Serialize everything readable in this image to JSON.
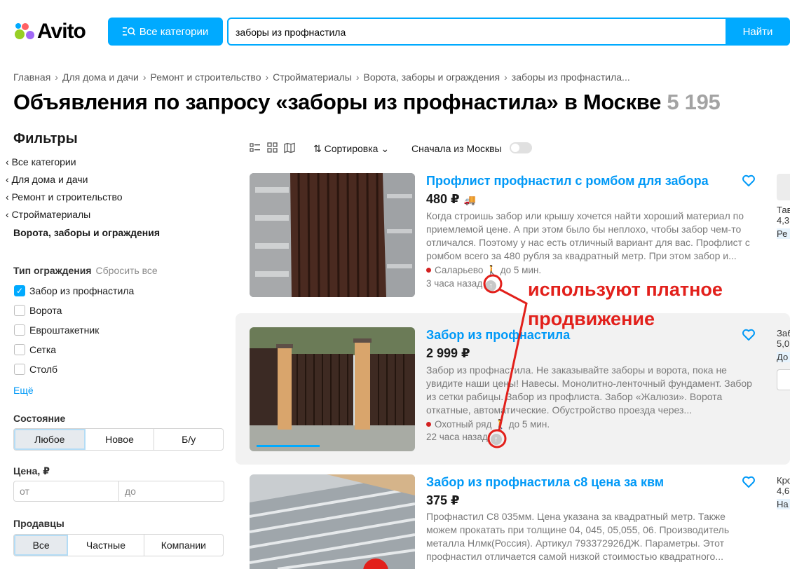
{
  "header": {
    "logo_text": "Avito",
    "categories_button": "Все категории",
    "search_value": "заборы из профнастила",
    "search_button": "Найти"
  },
  "breadcrumbs": [
    "Главная",
    "Для дома и дачи",
    "Ремонт и строительство",
    "Стройматериалы",
    "Ворота, заборы и ограждения",
    "заборы из профнастила..."
  ],
  "page_title": "Объявления по запросу «заборы из профнастила» в Москве",
  "results_count": "5 195",
  "filters": {
    "title": "Фильтры",
    "category_links": [
      "Все категории",
      "Для дома и дачи",
      "Ремонт и строительство",
      "Стройматериалы"
    ],
    "active_category": "Ворота, заборы и ограждения",
    "fence_type_label": "Тип ограждения",
    "reset_label": "Сбросить все",
    "fence_types": [
      {
        "label": "Забор из профнастила",
        "checked": true
      },
      {
        "label": "Ворота",
        "checked": false
      },
      {
        "label": "Евроштакетник",
        "checked": false
      },
      {
        "label": "Сетка",
        "checked": false
      },
      {
        "label": "Столб",
        "checked": false
      }
    ],
    "more_label": "Ещё",
    "condition_label": "Состояние",
    "condition_options": [
      "Любое",
      "Новое",
      "Б/у"
    ],
    "condition_selected": "Любое",
    "price_label": "Цена, ₽",
    "price_from_placeholder": "от",
    "price_to_placeholder": "до",
    "sellers_label": "Продавцы",
    "seller_options": [
      "Все",
      "Частные",
      "Компании"
    ],
    "seller_selected": "Все"
  },
  "toolbar": {
    "sort_label": "Сортировка",
    "moscow_first_label": "Сначала из Москвы",
    "moscow_first_on": false
  },
  "listings": [
    {
      "title": "Профлист профнастил с ромбом для забора",
      "price": "480 ₽",
      "description": "Когда строишь забор или крышу хочется найти хороший материал по приемлемой цене. А при этом было бы неплохо, чтобы забор чем-то отличался. Поэтому у нас есть отличный вариант для вас. Профлист с ромбом всего за 480 рубля за квадратный метр. При этом забор и...",
      "location": "Саларьево",
      "walk_time": "до 5 мин.",
      "posted": "3 часа назад",
      "seller_lines": [
        "Тав",
        "4,3",
        "Ре"
      ]
    },
    {
      "title": "Забор из профнастила",
      "price": "2 999 ₽",
      "description": "Забор из профнастила. Не заказывайте заборы и ворота, пока не увидите наши цены! Навесы. Монолитно-ленточный фундамент. Забор из сетки рабицы. Забор из профлиста. Забор «Жалюзи». Ворота откатные, автоматические. Обустройство проезда через...",
      "location": "Охотный ряд",
      "walk_time": "до 5 мин.",
      "posted": "22 часа назад",
      "seller_lines": [
        "Заб",
        "5,0",
        "До"
      ]
    },
    {
      "title": "Забор из профнастила с8 цена за квм",
      "price": "375 ₽",
      "description": "Профнастил С8 035мм. Цена указана за квадратный метр. Также можем прокатать при толщине 04, 045, 05,055, 06. Производитель металла Нлмк(Россия). Артикул 793372926ДЖ. Параметры. Этот профнастил отличается самой низкой стоимостью квадратного...",
      "seller_lines": [
        "Кро",
        "4,6",
        "На"
      ]
    }
  ],
  "annotation": {
    "line1": "используют платное",
    "line2": "продвижение",
    "color": "#e2201b"
  },
  "colors": {
    "accent": "#00aaff",
    "link": "#0099f7"
  }
}
